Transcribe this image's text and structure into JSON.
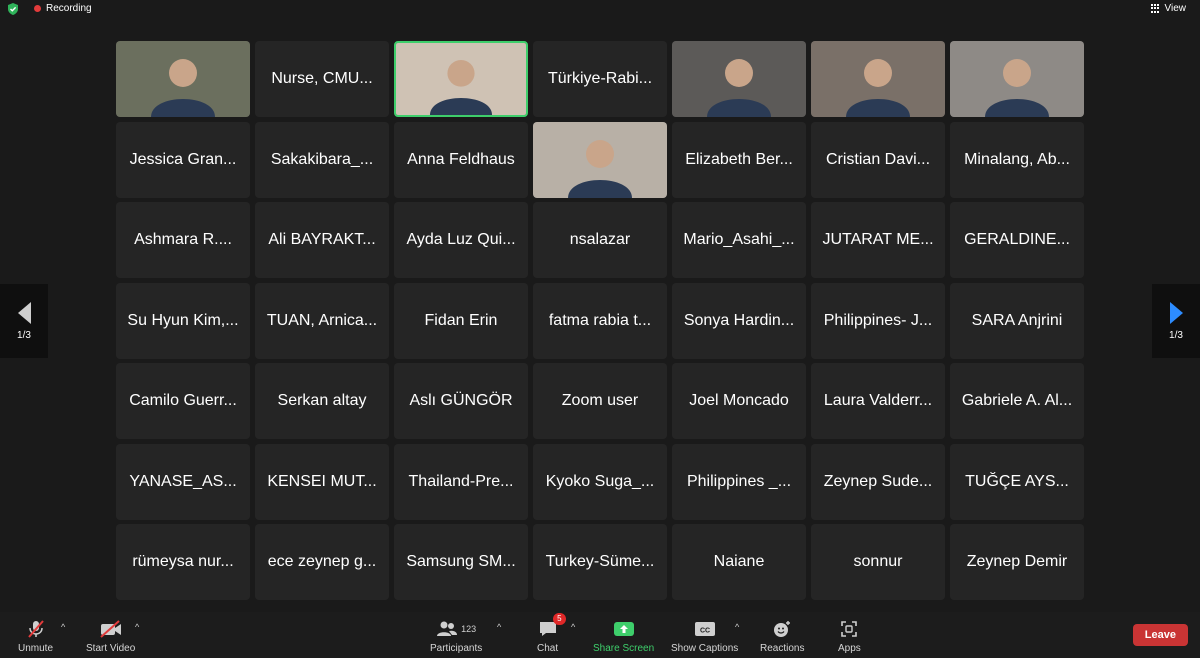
{
  "topbar": {
    "recording_label": "Recording",
    "view_label": "View"
  },
  "pagination": {
    "left": "1/3",
    "right": "1/3"
  },
  "tiles": [
    {
      "name": "",
      "video": true
    },
    {
      "name": "Nurse, CMU..."
    },
    {
      "name": "",
      "video": true,
      "active": true
    },
    {
      "name": "Türkiye-Rabi..."
    },
    {
      "name": "",
      "video": true
    },
    {
      "name": "",
      "video": true
    },
    {
      "name": "",
      "video": true
    },
    {
      "name": "Jessica Gran..."
    },
    {
      "name": "Sakakibara_..."
    },
    {
      "name": "Anna Feldhaus"
    },
    {
      "name": "",
      "video": true
    },
    {
      "name": "Elizabeth Ber..."
    },
    {
      "name": "Cristian Davi..."
    },
    {
      "name": "Minalang, Ab..."
    },
    {
      "name": "Ashmara R...."
    },
    {
      "name": "Ali BAYRAKT..."
    },
    {
      "name": "Ayda Luz Qui..."
    },
    {
      "name": "nsalazar"
    },
    {
      "name": "Mario_Asahi_..."
    },
    {
      "name": "JUTARAT ME..."
    },
    {
      "name": "GERALDINE..."
    },
    {
      "name": "Su Hyun Kim,..."
    },
    {
      "name": "TUAN, Arnica..."
    },
    {
      "name": "Fidan Erin"
    },
    {
      "name": "fatma rabia t..."
    },
    {
      "name": "Sonya Hardin..."
    },
    {
      "name": "Philippines- J..."
    },
    {
      "name": "SARA Anjrini"
    },
    {
      "name": "Camilo Guerr..."
    },
    {
      "name": "Serkan altay"
    },
    {
      "name": "Aslı GÜNGÖR"
    },
    {
      "name": "Zoom user"
    },
    {
      "name": "Joel Moncado"
    },
    {
      "name": "Laura Valderr..."
    },
    {
      "name": "Gabriele A. Al..."
    },
    {
      "name": "YANASE_AS..."
    },
    {
      "name": "KENSEI MUT..."
    },
    {
      "name": "Thailand-Pre..."
    },
    {
      "name": "Kyoko Suga_..."
    },
    {
      "name": "Philippines _..."
    },
    {
      "name": "Zeynep Sude..."
    },
    {
      "name": "TUĞÇE AYS..."
    },
    {
      "name": "rümeysa nur..."
    },
    {
      "name": "ece zeynep g..."
    },
    {
      "name": "Samsung SM..."
    },
    {
      "name": "Turkey-Süme..."
    },
    {
      "name": "Naiane"
    },
    {
      "name": "sonnur"
    },
    {
      "name": "Zeynep Demir"
    }
  ],
  "toolbar": {
    "unmute": "Unmute",
    "start_video": "Start Video",
    "participants": "Participants",
    "participants_count": "123",
    "chat": "Chat",
    "chat_badge": "5",
    "share_screen": "Share Screen",
    "show_captions": "Show Captions",
    "cc_text": "CC",
    "reactions": "Reactions",
    "apps": "Apps",
    "leave": "Leave"
  },
  "colors": {
    "share_green": "#3ece6b",
    "leave_red": "#c93434",
    "nav_blue": "#2d8cff"
  }
}
